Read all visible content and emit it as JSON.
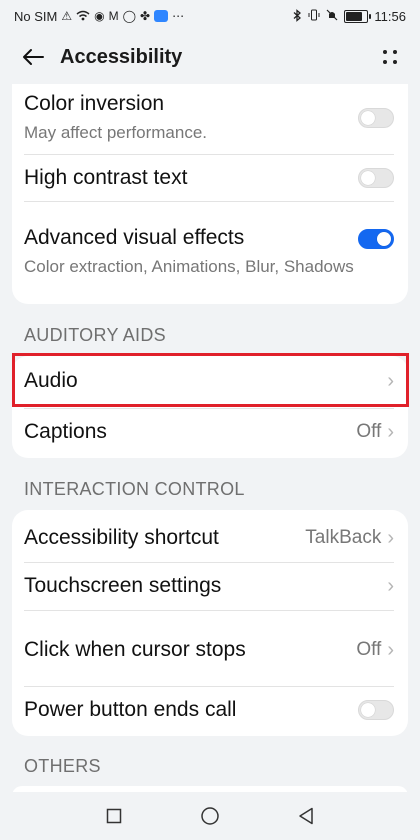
{
  "status_bar": {
    "carrier": "No SIM",
    "time": "11:56",
    "battery_level": 0.8,
    "icons": [
      "warning-icon",
      "wifi-icon",
      "notification-icon",
      "mail-icon",
      "whatsapp-icon",
      "app-icon",
      "cloud-icon",
      "more-dots-icon",
      "bluetooth-icon",
      "vibrate-icon",
      "mute-icon",
      "battery-icon"
    ]
  },
  "header": {
    "title": "Accessibility"
  },
  "display_card": {
    "items": [
      {
        "title": "Color inversion",
        "subtitle": "May affect performance.",
        "toggle": false
      },
      {
        "title": "High contrast text",
        "toggle": false
      },
      {
        "title": "Advanced visual effects",
        "subtitle": "Color extraction, Animations, Blur, Shadows",
        "toggle": true
      }
    ]
  },
  "auditory": {
    "label": "AUDITORY AIDS",
    "items": [
      {
        "title": "Audio"
      },
      {
        "title": "Captions",
        "value": "Off"
      }
    ]
  },
  "interaction": {
    "label": "INTERACTION CONTROL",
    "items": [
      {
        "title": "Accessibility shortcut",
        "value": "TalkBack"
      },
      {
        "title": "Touchscreen settings"
      },
      {
        "title": "Click when cursor stops",
        "value": "Off"
      },
      {
        "title": "Power button ends call",
        "toggle": false
      }
    ]
  },
  "others": {
    "label": "OTHERS"
  },
  "colors": {
    "accent": "#1468f0",
    "highlight": "#e0202a",
    "background": "#f1f3f5"
  }
}
